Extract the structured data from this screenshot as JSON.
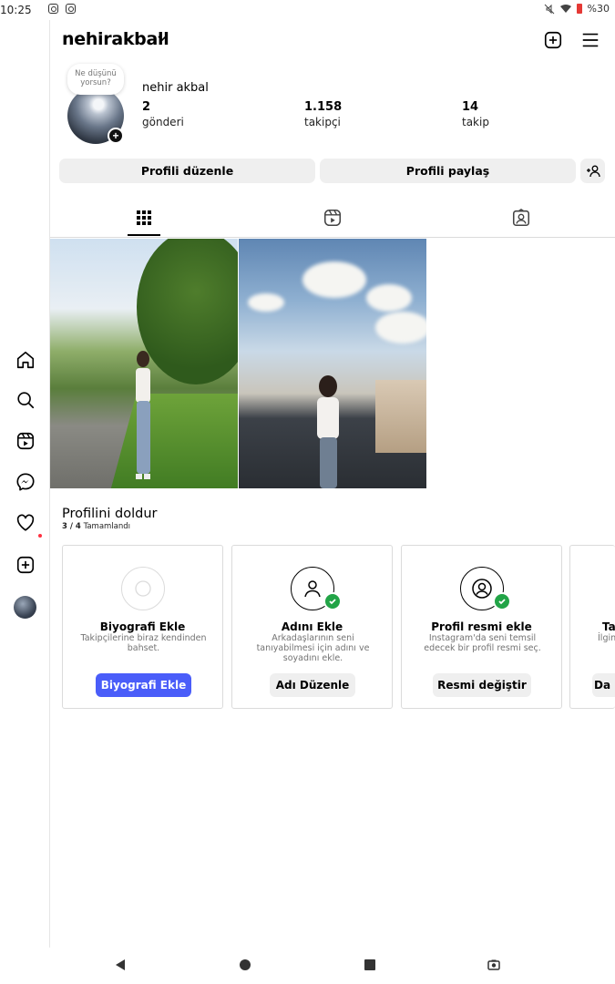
{
  "status_bar": {
    "time": "10:25",
    "battery": "%30"
  },
  "header": {
    "username": "nehirakball"
  },
  "profile": {
    "note": "Ne düşünü yorsun?",
    "display_name": "nehir akbal",
    "stats": [
      {
        "value": "2",
        "label": "gönderi"
      },
      {
        "value": "1.158",
        "label": "takipçi"
      },
      {
        "value": "14",
        "label": "takip"
      }
    ]
  },
  "actions": {
    "edit": "Profili düzenle",
    "share": "Profili paylaş"
  },
  "complete_profile": {
    "title": "Profilini doldur",
    "progress": "3 / 4",
    "progress_label": "Tamamlandı",
    "cards": [
      {
        "title": "Biyografi Ekle",
        "desc": "Takipçilerine biraz kendinden bahset.",
        "button": "Biyografi Ekle",
        "done": false
      },
      {
        "title": "Adını Ekle",
        "desc": "Arkadaşlarının seni tanıyabilmesi için adını ve soyadını ekle.",
        "button": "Adı Düzenle",
        "done": true
      },
      {
        "title": "Profil resmi ekle",
        "desc": "Instagram'da seni temsil edecek bir profil resmi seç.",
        "button": "Resmi değiştir",
        "done": true
      },
      {
        "title": "Tal",
        "desc": "İlgin a",
        "button": "Da",
        "done": false
      }
    ]
  },
  "colors": {
    "accent_blue": "#4a5df9",
    "check_green": "#22a447"
  }
}
